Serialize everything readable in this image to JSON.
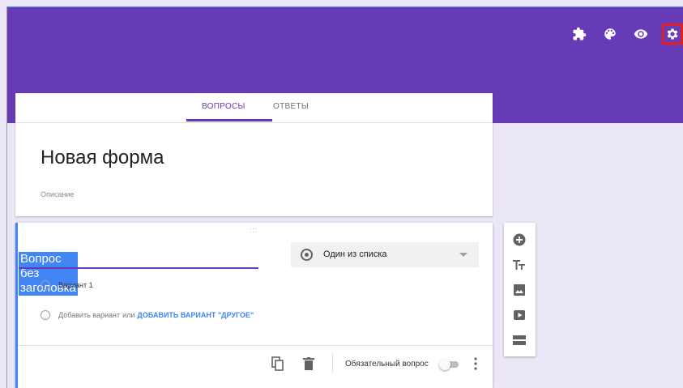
{
  "header": {
    "tools": [
      {
        "icon": "addon-icon",
        "label": "Дополнения"
      },
      {
        "icon": "palette-icon",
        "label": "Тема"
      },
      {
        "icon": "eye-icon",
        "label": "Просмотр"
      },
      {
        "icon": "gear-icon",
        "label": "Настройки"
      }
    ],
    "accent": "#673ab7",
    "highlight": "#e02020"
  },
  "tabs": [
    {
      "label": "ВОПРОСЫ",
      "active": true
    },
    {
      "label": "ОТВЕТЫ",
      "active": false
    }
  ],
  "form": {
    "title": "Новая форма",
    "description_placeholder": "Описание"
  },
  "question": {
    "drag_handle": ":::",
    "title": "Вопрос без заголовка",
    "type": "Один из списка",
    "options": [
      "Вариант 1"
    ],
    "add_option": "Добавить вариант",
    "or_text": "или",
    "add_other": "ДОБАВИТЬ ВАРИАНТ \"ДРУГОЕ\"",
    "required_label": "Обязательный вопрос",
    "required": false
  },
  "sidebar_tools": [
    "add-question-icon",
    "text-title-icon",
    "image-icon",
    "video-icon",
    "section-icon"
  ]
}
